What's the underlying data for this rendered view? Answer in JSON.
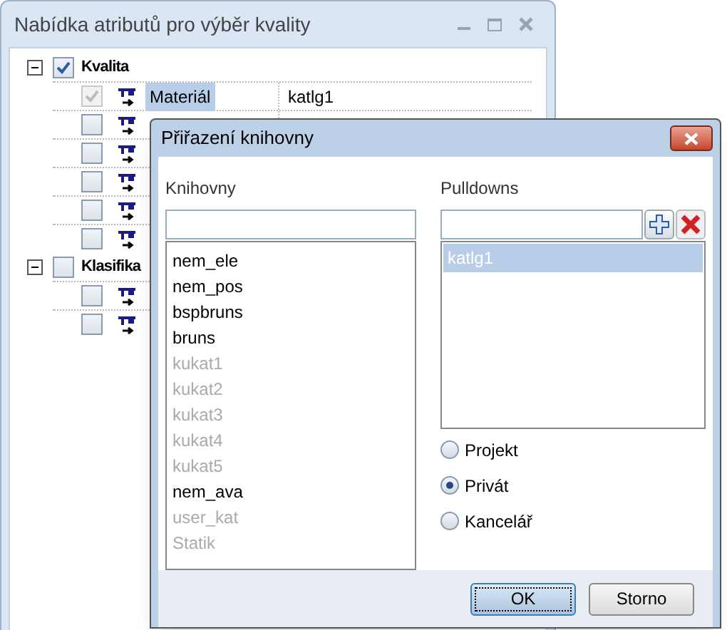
{
  "window": {
    "title": "Nabídka atributů pro výběr kvality"
  },
  "tree": [
    {
      "label": "Kvalita",
      "expanded": true,
      "checked": true,
      "rows": [
        {
          "checked": true,
          "disabled": true,
          "name": "Materiál",
          "value": "katlg1",
          "selected": true
        },
        {
          "checked": false,
          "disabled": false
        },
        {
          "checked": false,
          "disabled": false
        },
        {
          "checked": false,
          "disabled": false
        },
        {
          "checked": false,
          "disabled": false
        },
        {
          "checked": false,
          "disabled": false
        }
      ]
    },
    {
      "label": "Klasifika",
      "expanded": true,
      "checked": false,
      "rows": [
        {
          "checked": false,
          "disabled": false
        },
        {
          "checked": false,
          "disabled": false
        }
      ]
    }
  ],
  "dialog": {
    "title": "Přiřazení knihovny",
    "libraries": {
      "label": "Knihovny",
      "items": [
        {
          "label": "nem_ele",
          "disabled": false
        },
        {
          "label": "nem_pos",
          "disabled": false
        },
        {
          "label": "bspbruns",
          "disabled": false
        },
        {
          "label": "bruns",
          "disabled": false
        },
        {
          "label": "kukat1",
          "disabled": true
        },
        {
          "label": "kukat2",
          "disabled": true
        },
        {
          "label": "kukat3",
          "disabled": true
        },
        {
          "label": "kukat4",
          "disabled": true
        },
        {
          "label": "kukat5",
          "disabled": true
        },
        {
          "label": "nem_ava",
          "disabled": false
        },
        {
          "label": "user_kat",
          "disabled": true
        },
        {
          "label": "Statik",
          "disabled": true
        }
      ]
    },
    "pulldowns": {
      "label": "Pulldowns",
      "items": [
        {
          "label": "katlg1",
          "selected": true
        }
      ]
    },
    "scope": [
      {
        "label": "Projekt",
        "selected": false
      },
      {
        "label": "Privát",
        "selected": true
      },
      {
        "label": "Kancelář",
        "selected": false
      }
    ],
    "buttons": [
      {
        "label": "OK",
        "default": true
      },
      {
        "label": "Storno",
        "default": false
      }
    ]
  }
}
